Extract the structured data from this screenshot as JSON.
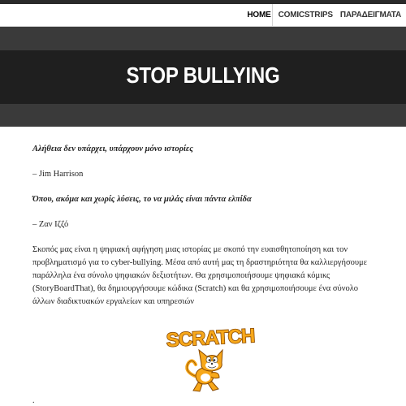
{
  "nav": {
    "items": [
      {
        "label": "HOME",
        "active": true
      },
      {
        "label": "COMICSTRIPS",
        "active": false
      },
      {
        "label": "ΠΑΡΑΔΕΙΓΜΑΤΑ",
        "active": false
      }
    ]
  },
  "hero": {
    "title": "STOP BULLYING"
  },
  "content": {
    "quote1": "Αλήθεια δεν υπάρχει, υπάρχουν μόνο ιστορίες",
    "author1": "– Jim Harrison",
    "quote2": "Όπου, ακόμα και χωρίς λύσεις, το να μιλάς είναι πάντα ελπίδα",
    "author2": "– Ζαν Ιζζό",
    "paragraph": "Σκοπός μας είναι η ψηφιακή αφήγηση μιας ιστορίας με σκοπό την ευαισθητοποίηση και τον προβληματισμό για το cyber-bullying. Μέσα από αυτή μας τη δραστηριότητα θα καλλιεργήσουμε παράλληλα ένα σύνολο ψηφιακών δεξιοτήτων. Θα χρησιμοποιήσουμε ψηφιακά κόμικς (StoryBoardThat), θα δημιουργήσουμε κώδικα (Scratch) και θα χρησιμοποιήσουμε ένα σύνολο άλλων διαδικτυακών εργαλείων και υπηρεσιών",
    "logo_text": "SCRATCH",
    "trailing": "."
  },
  "colors": {
    "topbar": "#2a2a2a",
    "hero_outer": "#3a3a3a",
    "hero_band": "#1f1f1f",
    "scratch_orange": "#f7a81b"
  }
}
